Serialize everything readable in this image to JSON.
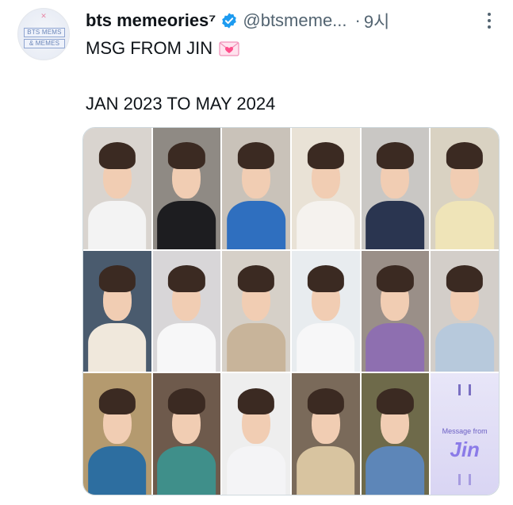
{
  "tweet": {
    "avatar_text_1": "BTS MEMS",
    "avatar_text_2": "& MEMES",
    "display_name": "bts memeories⁷",
    "handle": "@btsmeme...",
    "separator": "·",
    "time": "9시",
    "text_line1": "MSG FROM JIN",
    "text_line2": "JAN 2023 TO MAY 2024"
  },
  "media": {
    "tiles": [
      {
        "bg": "#d9d4cf",
        "top": "#f3f3f3"
      },
      {
        "bg": "#8f8a84",
        "top": "#1d1d20"
      },
      {
        "bg": "#c9c2b9",
        "top": "#2f6fbf"
      },
      {
        "bg": "#e9e2d6",
        "top": "#f5f2ee"
      },
      {
        "bg": "#c9c7c4",
        "top": "#2a3550"
      },
      {
        "bg": "#d9d2c2",
        "top": "#efe4b8"
      },
      {
        "bg": "#4a5b6e",
        "top": "#f0e8dc"
      },
      {
        "bg": "#d8d6d8",
        "top": "#f7f7f8"
      },
      {
        "bg": "#d6d0c8",
        "top": "#c8b49a"
      },
      {
        "bg": "#e8ecef",
        "top": "#f7f7f8"
      },
      {
        "bg": "#9a8f88",
        "top": "#8e6fb0"
      },
      {
        "bg": "#d3cec9",
        "top": "#b7c9dc"
      },
      {
        "bg": "#b49a6f",
        "top": "#2d6ea0"
      },
      {
        "bg": "#6e5a4c",
        "top": "#3f8f8a"
      },
      {
        "bg": "#eeeeee",
        "top": "#f4f4f6"
      },
      {
        "bg": "#7a6a5a",
        "top": "#d8c4a0"
      },
      {
        "bg": "#6e6a4a",
        "top": "#5d86b8"
      }
    ],
    "message_card": {
      "label_small": "Message from",
      "label_big": "Jin"
    }
  },
  "colors": {
    "verified": "#1d9bf0",
    "heart": "#ff4f8b"
  },
  "icons": [
    "verified-badge-icon",
    "heart-letter-emoji-icon",
    "more-options-icon"
  ]
}
